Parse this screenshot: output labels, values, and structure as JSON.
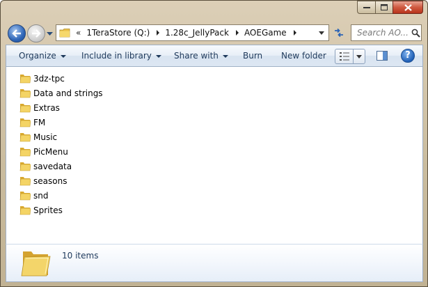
{
  "window": {
    "caption_buttons": [
      {
        "name": "minimize",
        "icon": "minimize-icon"
      },
      {
        "name": "maximize",
        "icon": "maximize-icon"
      },
      {
        "name": "close",
        "icon": "close-icon"
      }
    ]
  },
  "address_bar": {
    "overflow_chevron": "«",
    "crumbs": [
      "1TeraStore (Q:)",
      "1.28c_JellyPack",
      "AOEGame"
    ]
  },
  "search": {
    "placeholder": "Search AO..."
  },
  "command_bar": {
    "organize": "Organize",
    "include_in_library": "Include in library",
    "share_with": "Share with",
    "burn": "Burn",
    "new_folder": "New folder",
    "help": "?"
  },
  "files": [
    {
      "name": "3dz-tpc"
    },
    {
      "name": "Data and strings"
    },
    {
      "name": "Extras"
    },
    {
      "name": "FM"
    },
    {
      "name": "Music"
    },
    {
      "name": "PicMenu"
    },
    {
      "name": "savedata"
    },
    {
      "name": "seasons"
    },
    {
      "name": "snd"
    },
    {
      "name": "Sprites"
    }
  ],
  "details_pane": {
    "item_count": "10 items"
  },
  "colors": {
    "frame": "#cbbd9f",
    "command_bar_text": "#1e395b",
    "close_button": "#c8452c",
    "folder": "#f2cf5c"
  }
}
